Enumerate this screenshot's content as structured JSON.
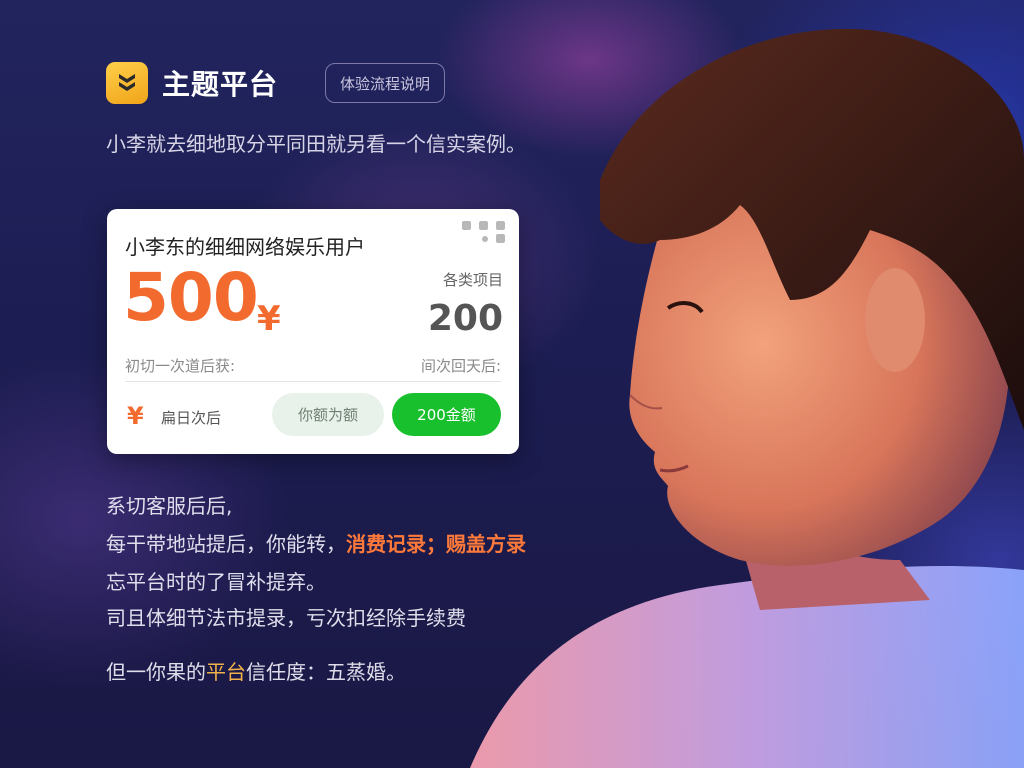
{
  "header": {
    "brand": "主题平台",
    "tag": "体验流程说明"
  },
  "subtitle": "小李就去细地取分平同田就另看一个信实案例。",
  "card": {
    "title": "小李东的细细网络娱乐用户",
    "amount": "500",
    "amount_unit": "¥",
    "right_label": "各类项目",
    "right_value": "200",
    "row_left": "初切一次道后获:",
    "row_right": "间次回天后:",
    "yen_symbol": "¥",
    "yen_text": "扁日次后",
    "btn_secondary": "你额为额",
    "btn_primary": "200金额"
  },
  "body": {
    "line1": "系切客服后后,",
    "line2_prefix": "每干带地站提后，你能转，",
    "line2_highlight": "消费记录；赐盖方录",
    "line3": "忘平台时的了冒补提弃。",
    "line4": "司且体细节法市提录，亏次扣经除手续费",
    "line5_prefix": "但一你果的",
    "line5_highlight": "平台",
    "line5_suffix": "信任度：五蒸婚。"
  },
  "colors": {
    "accent_orange": "#f26a2e",
    "primary_green": "#19c02d",
    "logo_yellow": "#f5b52a"
  },
  "icons": {
    "logo": "shield-logo-icon",
    "yen": "yen-icon"
  }
}
